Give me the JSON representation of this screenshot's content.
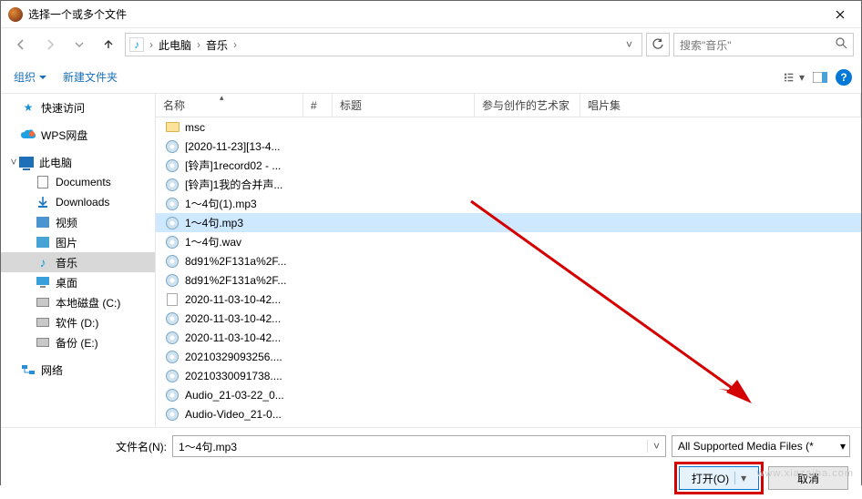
{
  "window": {
    "title": "选择一个或多个文件"
  },
  "nav": {
    "segments": [
      "此电脑",
      "音乐"
    ],
    "search_placeholder": "搜索\"音乐\""
  },
  "toolbar": {
    "organize": "组织",
    "new_folder": "新建文件夹"
  },
  "sidebar": {
    "quick_access": "快速访问",
    "wps": "WPS网盘",
    "this_pc": "此电脑",
    "documents": "Documents",
    "downloads": "Downloads",
    "videos": "视频",
    "pictures": "图片",
    "music": "音乐",
    "desktop": "桌面",
    "local_c": "本地磁盘 (C:)",
    "soft_d": "软件 (D:)",
    "backup_e": "备份 (E:)",
    "network": "网络"
  },
  "columns": {
    "name": "名称",
    "num": "#",
    "title": "标题",
    "artist": "参与创作的艺术家",
    "album": "唱片集"
  },
  "files": [
    {
      "icon": "folder",
      "name": "msc"
    },
    {
      "icon": "audio",
      "name": "[2020-11-23][13-4..."
    },
    {
      "icon": "audio",
      "name": "[铃声]1record02 - ..."
    },
    {
      "icon": "audio",
      "name": "[铃声]1我的合并声..."
    },
    {
      "icon": "audio",
      "name": "1～4句(1).mp3"
    },
    {
      "icon": "audio",
      "name": "1～4句.mp3",
      "selected": true
    },
    {
      "icon": "audio",
      "name": "1～4句.wav"
    },
    {
      "icon": "audio",
      "name": "8d91%2F131a%2F..."
    },
    {
      "icon": "audio",
      "name": "8d91%2F131a%2F..."
    },
    {
      "icon": "doc",
      "name": "2020-11-03-10-42..."
    },
    {
      "icon": "audio",
      "name": "2020-11-03-10-42..."
    },
    {
      "icon": "audio",
      "name": "2020-11-03-10-42..."
    },
    {
      "icon": "audio",
      "name": "20210329093256...."
    },
    {
      "icon": "audio",
      "name": "20210330091738...."
    },
    {
      "icon": "audio",
      "name": "Audio_21-03-22_0..."
    },
    {
      "icon": "audio",
      "name": "Audio-Video_21-0..."
    }
  ],
  "footer": {
    "filename_label": "文件名(N):",
    "filename_value": "1～4句.mp3",
    "filetype": "All Supported Media Files (*",
    "open": "打开(O)",
    "cancel": "取消"
  }
}
